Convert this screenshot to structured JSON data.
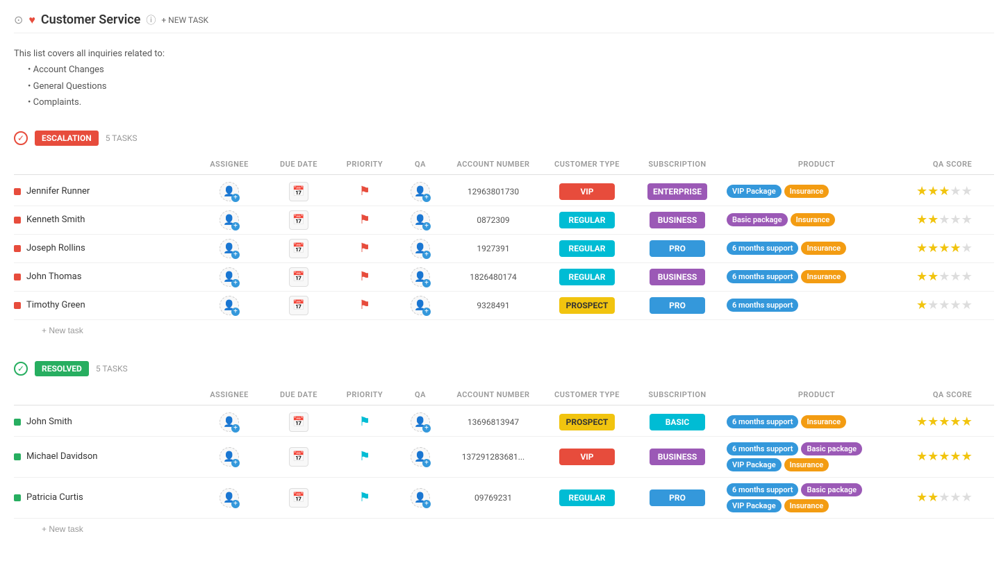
{
  "header": {
    "title": "Customer Service",
    "info_label": "ⓘ",
    "new_task_label": "NEW TASK"
  },
  "description": {
    "intro": "This list covers all inquiries related to:",
    "items": [
      "Account Changes",
      "General Questions",
      "Complaints."
    ]
  },
  "columns": {
    "task_name": "",
    "assignee": "ASSIGNEE",
    "due_date": "DUE DATE",
    "priority": "PRIORITY",
    "qa": "QA",
    "account_number": "ACCOUNT NUMBER",
    "customer_type": "CUSTOMER TYPE",
    "subscription": "SUBSCRIPTION",
    "product": "PRODUCT",
    "qa_score": "QA SCORE"
  },
  "sections": [
    {
      "id": "escalation",
      "badge": "ESCALATION",
      "type": "escalation",
      "task_count": "5 TASKS",
      "new_task_label": "+ New task",
      "tasks": [
        {
          "name": "Jennifer Runner",
          "indicator": "red",
          "account_number": "12963801730",
          "customer_type": "VIP",
          "customer_type_class": "vip",
          "subscription": "ENTERPRISE",
          "subscription_class": "enterprise",
          "products": [
            {
              "label": "VIP Package",
              "class": "vip-package"
            },
            {
              "label": "Insurance",
              "class": "insurance"
            }
          ],
          "stars": 3,
          "flag_color": "red"
        },
        {
          "name": "Kenneth Smith",
          "indicator": "red",
          "account_number": "0872309",
          "customer_type": "REGULAR",
          "customer_type_class": "regular",
          "subscription": "BUSINESS",
          "subscription_class": "business",
          "products": [
            {
              "label": "Basic package",
              "class": "basic-package"
            },
            {
              "label": "Insurance",
              "class": "insurance"
            }
          ],
          "stars": 2,
          "flag_color": "red"
        },
        {
          "name": "Joseph Rollins",
          "indicator": "red",
          "account_number": "1927391",
          "customer_type": "REGULAR",
          "customer_type_class": "regular",
          "subscription": "PRO",
          "subscription_class": "pro",
          "products": [
            {
              "label": "6 months support",
              "class": "six-months"
            },
            {
              "label": "Insurance",
              "class": "insurance"
            }
          ],
          "stars": 4,
          "flag_color": "red"
        },
        {
          "name": "John Thomas",
          "indicator": "red",
          "account_number": "1826480174",
          "customer_type": "REGULAR",
          "customer_type_class": "regular",
          "subscription": "BUSINESS",
          "subscription_class": "business",
          "products": [
            {
              "label": "6 months support",
              "class": "six-months"
            },
            {
              "label": "Insurance",
              "class": "insurance"
            }
          ],
          "stars": 2,
          "flag_color": "red"
        },
        {
          "name": "Timothy Green",
          "indicator": "red",
          "account_number": "9328491",
          "customer_type": "PROSPECT",
          "customer_type_class": "prospect",
          "subscription": "PRO",
          "subscription_class": "pro",
          "products": [
            {
              "label": "6 months support",
              "class": "six-months"
            }
          ],
          "stars": 1,
          "flag_color": "red"
        }
      ]
    },
    {
      "id": "resolved",
      "badge": "RESOLVED",
      "type": "resolved",
      "task_count": "5 TASKS",
      "new_task_label": "+ New task",
      "tasks": [
        {
          "name": "John Smith",
          "indicator": "green",
          "account_number": "13696813947",
          "customer_type": "PROSPECT",
          "customer_type_class": "prospect",
          "subscription": "BASIC",
          "subscription_class": "basic",
          "products": [
            {
              "label": "6 months support",
              "class": "six-months"
            },
            {
              "label": "Insurance",
              "class": "insurance"
            }
          ],
          "stars": 5,
          "flag_color": "cyan"
        },
        {
          "name": "Michael Davidson",
          "indicator": "green",
          "account_number": "137291283681...",
          "customer_type": "VIP",
          "customer_type_class": "vip",
          "subscription": "BUSINESS",
          "subscription_class": "business",
          "products": [
            {
              "label": "6 months support",
              "class": "six-months"
            },
            {
              "label": "Basic package",
              "class": "basic-package"
            },
            {
              "label": "VIP Package",
              "class": "vip-package"
            },
            {
              "label": "Insurance",
              "class": "insurance"
            }
          ],
          "stars": 5,
          "flag_color": "cyan"
        },
        {
          "name": "Patricia Curtis",
          "indicator": "green",
          "account_number": "09769231",
          "customer_type": "REGULAR",
          "customer_type_class": "regular",
          "subscription": "PRO",
          "subscription_class": "pro",
          "products": [
            {
              "label": "6 months support",
              "class": "six-months"
            },
            {
              "label": "Basic package",
              "class": "basic-package"
            },
            {
              "label": "VIP Package",
              "class": "vip-package"
            },
            {
              "label": "Insurance",
              "class": "insurance"
            }
          ],
          "stars": 2,
          "flag_color": "cyan"
        }
      ]
    }
  ]
}
